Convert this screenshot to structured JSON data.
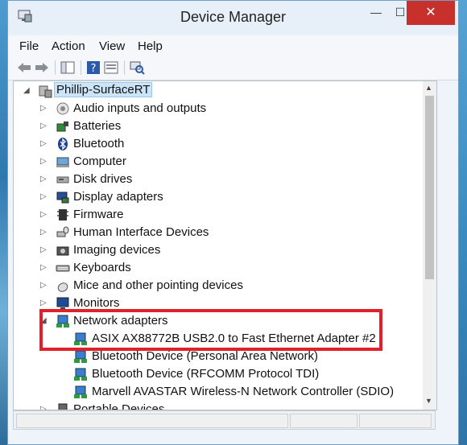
{
  "window": {
    "title": "Device Manager"
  },
  "titlebar": {
    "minimize": "—",
    "maximize": "☐",
    "close": "✕"
  },
  "menu": [
    "File",
    "Action",
    "View",
    "Help"
  ],
  "toolbar": {
    "icons": [
      "back-arrow-icon",
      "forward-arrow-icon",
      "show-hide-tree-icon",
      "help-icon",
      "properties-icon",
      "scan-hardware-icon"
    ]
  },
  "tree": {
    "root": "Phillip-SurfaceRT",
    "categories": [
      {
        "label": "Audio inputs and outputs",
        "icon": "speaker-icon"
      },
      {
        "label": "Batteries",
        "icon": "battery-icon"
      },
      {
        "label": "Bluetooth",
        "icon": "bluetooth-icon"
      },
      {
        "label": "Computer",
        "icon": "computer-icon"
      },
      {
        "label": "Disk drives",
        "icon": "disk-drive-icon"
      },
      {
        "label": "Display adapters",
        "icon": "display-adapter-icon"
      },
      {
        "label": "Firmware",
        "icon": "firmware-icon"
      },
      {
        "label": "Human Interface Devices",
        "icon": "hid-icon"
      },
      {
        "label": "Imaging devices",
        "icon": "camera-icon"
      },
      {
        "label": "Keyboards",
        "icon": "keyboard-icon"
      },
      {
        "label": "Mice and other pointing devices",
        "icon": "mouse-icon"
      },
      {
        "label": "Monitors",
        "icon": "monitor-icon"
      },
      {
        "label": "Network adapters",
        "icon": "network-adapter-icon"
      },
      {
        "label": "Portable Devices",
        "icon": "portable-device-icon"
      }
    ],
    "network_children": [
      "ASIX AX88772B USB2.0 to Fast Ethernet Adapter #2",
      "Bluetooth Device (Personal Area Network)",
      "Bluetooth Device (RFCOMM Protocol TDI)",
      "Marvell AVASTAR Wireless-N Network Controller (SDIO)"
    ],
    "collapsed_glyph": "▷",
    "expanded_glyph": "◢"
  },
  "colors": {
    "close_button": "#c7302b",
    "highlight": "#e0202a",
    "selection": "#cce4f7"
  }
}
